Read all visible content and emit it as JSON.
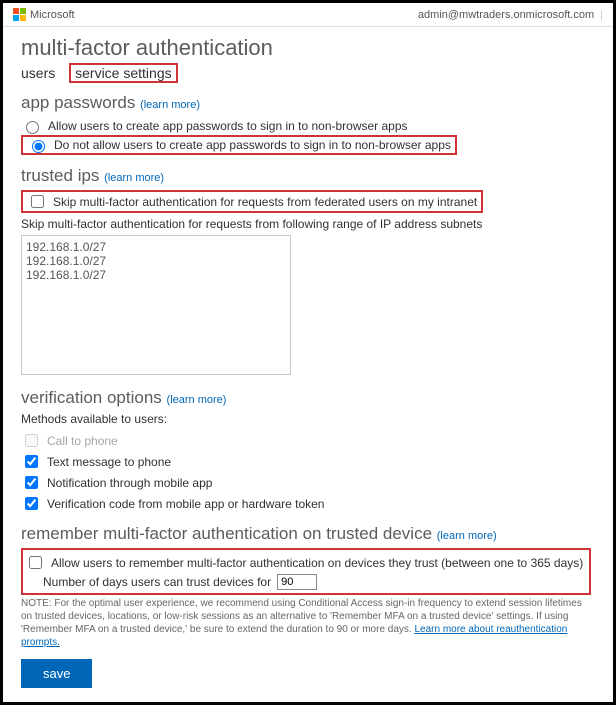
{
  "header": {
    "brand": "Microsoft",
    "account": "admin@mwtraders.onmicrosoft.com"
  },
  "page": {
    "title": "multi-factor authentication"
  },
  "tabs": {
    "users": "users",
    "service_settings": "service settings"
  },
  "learn_more": "(learn more)",
  "app_passwords": {
    "heading": "app passwords",
    "allow": "Allow users to create app passwords to sign in to non-browser apps",
    "disallow": "Do not allow users to create app passwords to sign in to non-browser apps"
  },
  "trusted_ips": {
    "heading": "trusted ips",
    "skip_federated": "Skip multi-factor authentication for requests from federated users on my intranet",
    "range_label": "Skip multi-factor authentication for requests from following range of IP address subnets",
    "ips": "192.168.1.0/27\n192.168.1.0/27\n192.168.1.0/27"
  },
  "verification": {
    "heading": "verification options",
    "methods_label": "Methods available to users:",
    "call": "Call to phone",
    "text": "Text message to phone",
    "app_notify": "Notification through mobile app",
    "code": "Verification code from mobile app or hardware token"
  },
  "remember": {
    "heading": "remember multi-factor authentication on trusted device",
    "allow": "Allow users to remember multi-factor authentication on devices they trust (between one to 365 days)",
    "days_label_pre": "Number of days users can trust devices for",
    "days_value": "90",
    "note_pre": "NOTE: For the optimal user experience, we recommend using Conditional Access sign-in frequency to extend session lifetimes on trusted devices, locations, or low-risk sessions as an alternative to 'Remember MFA on a trusted device' settings. If using 'Remember MFA on a trusted device,' be sure to extend the duration to 90 or more days. ",
    "note_link": "Learn more about reauthentication prompts."
  },
  "save": "save"
}
